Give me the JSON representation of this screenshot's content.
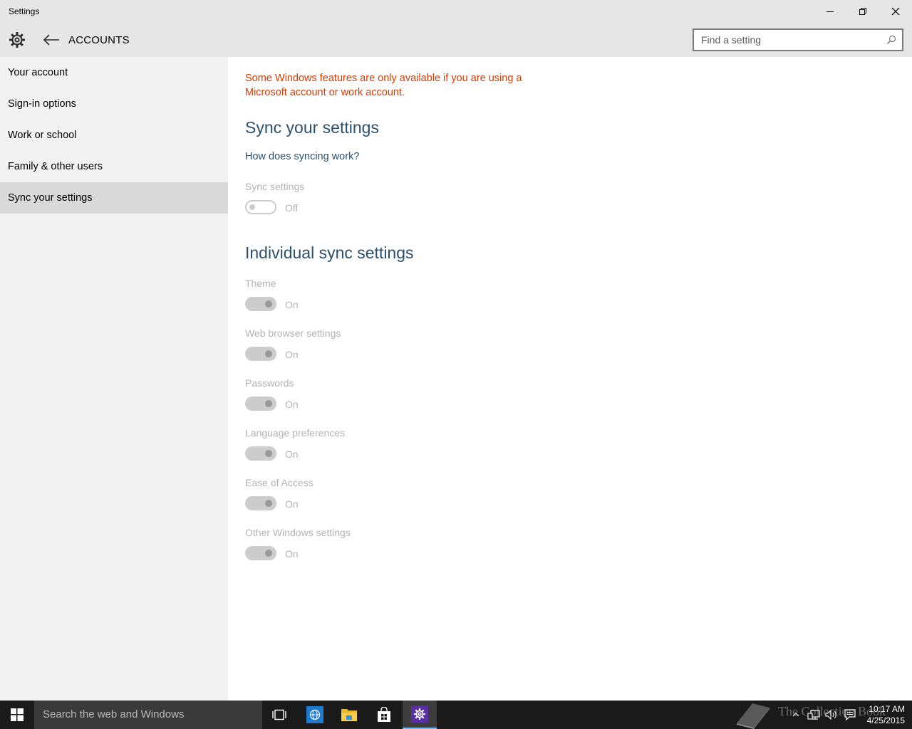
{
  "window": {
    "title": "Settings"
  },
  "header": {
    "section_title": "ACCOUNTS",
    "search_placeholder": "Find a setting"
  },
  "sidebar": {
    "items": [
      {
        "label": "Your account"
      },
      {
        "label": "Sign-in options"
      },
      {
        "label": "Work or school"
      },
      {
        "label": "Family & other users"
      },
      {
        "label": "Sync your settings",
        "selected": true
      }
    ]
  },
  "main": {
    "warning": "Some Windows features are only available if you are using a Microsoft account or work account.",
    "sync_heading": "Sync your settings",
    "sync_link": "How does syncing work?",
    "sync_toggle": {
      "label": "Sync settings",
      "state": "Off"
    },
    "individual_heading": "Individual sync settings",
    "individual": [
      {
        "label": "Theme",
        "state": "On"
      },
      {
        "label": "Web browser settings",
        "state": "On"
      },
      {
        "label": "Passwords",
        "state": "On"
      },
      {
        "label": "Language preferences",
        "state": "On"
      },
      {
        "label": "Ease of Access",
        "state": "On"
      },
      {
        "label": "Other Windows settings",
        "state": "On"
      }
    ]
  },
  "taskbar": {
    "search_placeholder": "Search the web and Windows",
    "watermark": "The Collection Book",
    "time": "10:17 AM",
    "date": "4/25/2015"
  },
  "colors": {
    "warning": "#d83b01",
    "heading": "#2b4f6e",
    "sidebar_bg": "#f2f2f2",
    "selected_bg": "#d9d9d9",
    "taskbar": "#1a1a1a"
  }
}
